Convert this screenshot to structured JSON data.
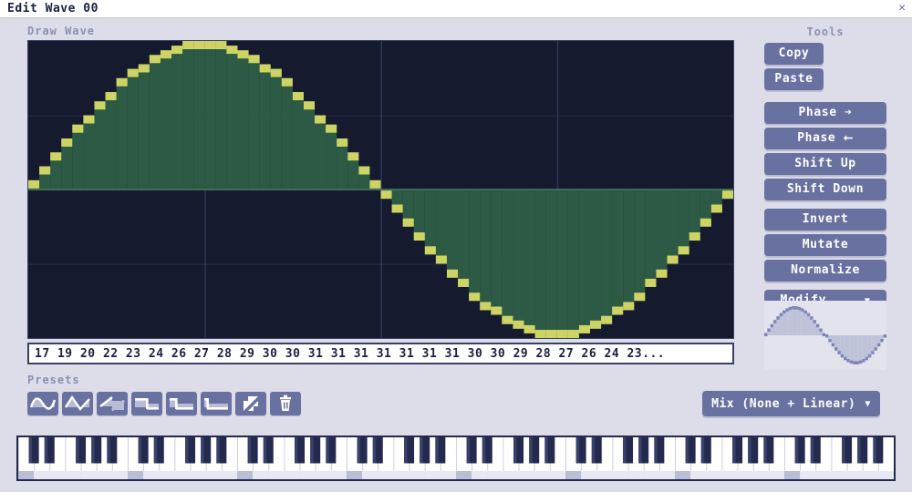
{
  "window": {
    "title": "Edit Wave 00",
    "close_label": "✕"
  },
  "draw": {
    "label": "Draw Wave",
    "values_text": "17 19 20 22 23 24 26 27 28 29 30 30 31 31 31 31 31 31 31 30 30 29 28 27 26 24 23...",
    "values": [
      17,
      19,
      20,
      22,
      23,
      24,
      26,
      27,
      28,
      29,
      30,
      30,
      31,
      31,
      31,
      31,
      31,
      31,
      31,
      30,
      30,
      29,
      28,
      27,
      26,
      24,
      23
    ],
    "colors": {
      "background": "#151a2e",
      "grid": "#323a5c",
      "step": "#cdd464",
      "fill": "#2d5a45",
      "border": "#3a4060"
    }
  },
  "presets": {
    "label": "Presets",
    "items": [
      {
        "name": "preset-sine",
        "icon": "sine-wave-icon"
      },
      {
        "name": "preset-triangle",
        "icon": "triangle-wave-icon"
      },
      {
        "name": "preset-saw",
        "icon": "saw-wave-icon"
      },
      {
        "name": "preset-square",
        "icon": "square-wave-icon"
      },
      {
        "name": "preset-pulse-25",
        "icon": "pulse-25-wave-icon"
      },
      {
        "name": "preset-pulse-12",
        "icon": "pulse-12-wave-icon"
      },
      {
        "name": "preset-noise",
        "icon": "noise-icon"
      },
      {
        "name": "preset-clear",
        "icon": "trash-icon"
      }
    ]
  },
  "mix": {
    "label": "Mix (None + Linear)",
    "chevron": "▼"
  },
  "tools": {
    "label": "Tools",
    "copy_label": "Copy",
    "paste_label": "Paste",
    "phase_forward_label": "Phase ➔",
    "phase_back_label": "Phase ⭠",
    "shift_up_label": "Shift Up",
    "shift_down_label": "Shift Down",
    "invert_label": "Invert",
    "mutate_label": "Mutate",
    "normalize_label": "Normalize",
    "modify_label": "Modify...",
    "modify_chevron": "▼"
  },
  "theme": {
    "panel_bg": "#dcdde8",
    "button_bg": "#6971a0",
    "button_text": "#ffffff",
    "label_text": "#8a90b4",
    "title_text": "#1b2140",
    "strip_bg": "#ffffff",
    "strip_border": "#3a3f66",
    "key_white": "#ffffff",
    "key_black": "#232a4d"
  }
}
